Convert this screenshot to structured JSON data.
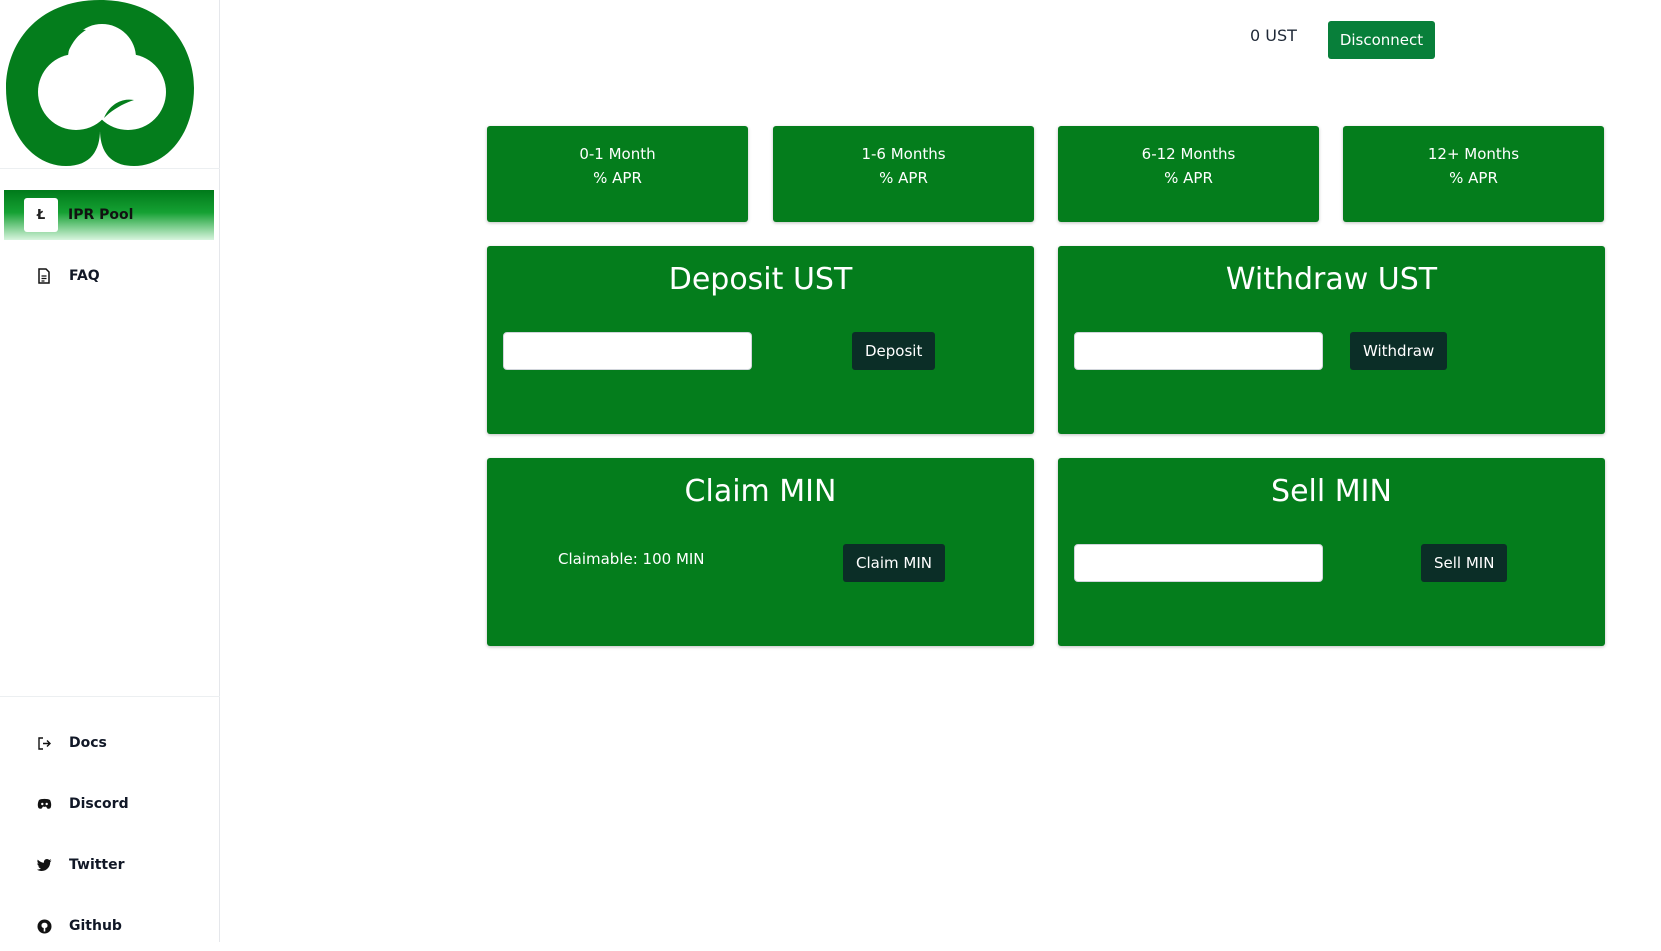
{
  "sidebar": {
    "logo": "clover-logo",
    "nav": [
      {
        "label": "IPR Pool",
        "icon": "pool-icon",
        "icon_glyph": "Ł",
        "active": true
      },
      {
        "label": "FAQ",
        "icon": "document-icon",
        "icon_glyph": "🗎"
      }
    ],
    "links": [
      {
        "label": "Docs",
        "icon": "sign-out-icon",
        "icon_glyph": "⇥"
      },
      {
        "label": "Discord",
        "icon": "discord-icon",
        "icon_glyph": "◉"
      },
      {
        "label": "Twitter",
        "icon": "twitter-icon",
        "icon_glyph": "🐦"
      },
      {
        "label": "Github",
        "icon": "github-icon",
        "icon_glyph": "◎"
      }
    ]
  },
  "header": {
    "balance": "0 UST",
    "disconnect_label": "Disconnect"
  },
  "apr_cards": [
    {
      "period": "0-1 Month",
      "apr": "% APR"
    },
    {
      "period": "1-6 Months",
      "apr": "% APR"
    },
    {
      "period": "6-12 Months",
      "apr": "% APR"
    },
    {
      "period": "12+ Months",
      "apr": "% APR"
    }
  ],
  "panels": {
    "deposit": {
      "title": "Deposit UST",
      "input_value": "",
      "button": "Deposit"
    },
    "withdraw": {
      "title": "Withdraw UST",
      "input_value": "",
      "button": "Withdraw"
    },
    "claim": {
      "title": "Claim MIN",
      "claimable": "Claimable: 100 MIN",
      "button": "Claim MIN"
    },
    "sell": {
      "title": "Sell MIN",
      "input_value": "",
      "button": "Sell MIN"
    }
  },
  "colors": {
    "primary_green": "#047d1c",
    "dark_button": "#0b2e27",
    "disconnect": "#087f3a"
  }
}
